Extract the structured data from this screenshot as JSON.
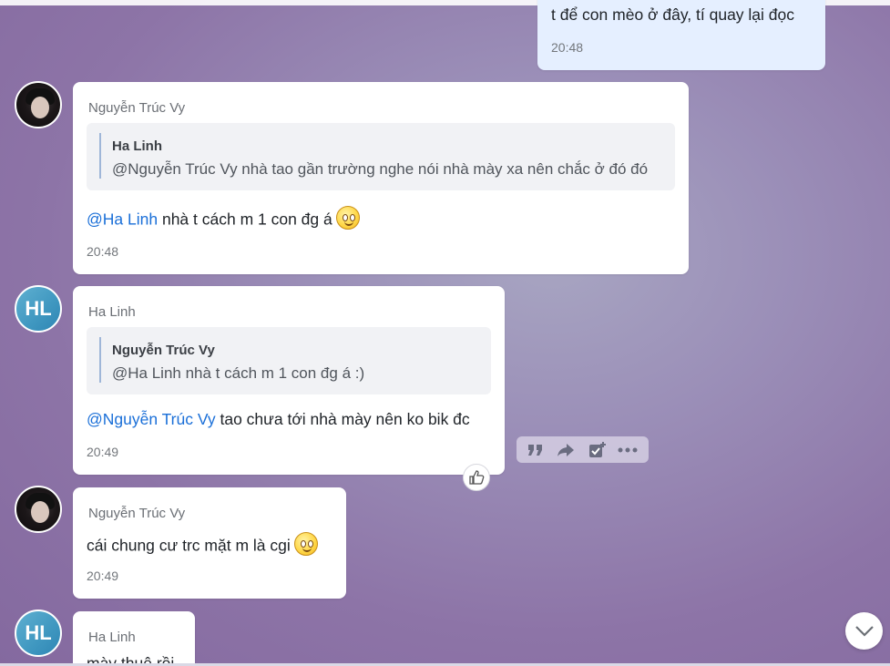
{
  "messages": [
    {
      "text": "t để con mèo ở đây, tí quay lại đọc",
      "time": "20:48"
    },
    {
      "sender": "Nguyễn Trúc Vy",
      "quote": {
        "name": "Ha Linh",
        "text": "@Nguyễn Trúc Vy nhà tao gần trường nghe nói nhà mày xa nên chắc ở đó đó"
      },
      "mention": "@Ha Linh",
      "text": " nhà t cách m 1 con đg á",
      "time": "20:48"
    },
    {
      "sender": "Ha Linh",
      "avatar_initials": "HL",
      "quote": {
        "name": "Nguyễn Trúc Vy",
        "text": "@Ha Linh nhà t cách m 1 con đg á :)"
      },
      "mention": "@Nguyễn Trúc Vy",
      "text": " tao chưa tới nhà mày nên ko bik đc",
      "time": "20:49"
    },
    {
      "sender": "Nguyễn Trúc Vy",
      "text": "cái chung cư trc mặt m là cgi",
      "time": "20:49"
    },
    {
      "sender": "Ha Linh",
      "avatar_initials": "HL",
      "text": "mày thuê rồi"
    }
  ],
  "toolbar": {
    "icons": [
      "quote-icon",
      "forward-icon",
      "add-task-icon",
      "more-icon"
    ]
  },
  "colors": {
    "mention": "#1a6fd8",
    "my_bubble": "#e5efff",
    "avatar_bg": "#3f97c0"
  }
}
